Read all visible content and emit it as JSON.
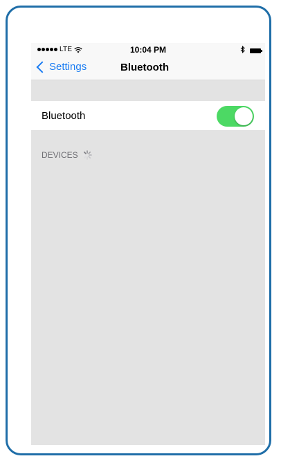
{
  "status_bar": {
    "carrier": "LTE",
    "time": "10:04 PM",
    "bluetooth_symbol": "∗"
  },
  "nav": {
    "back_label": "Settings",
    "title": "Bluetooth"
  },
  "toggle_row": {
    "label": "Bluetooth",
    "state": "on"
  },
  "devices_section": {
    "header": "DEVICES"
  },
  "colors": {
    "frame": "#1f6ea8",
    "accent_blue": "#1a7cf2",
    "toggle_on": "#4cd964",
    "screen_background": "#e3e3e3"
  },
  "icons": {
    "back": "chevron-left-icon",
    "wifi": "wifi-icon",
    "bluetooth": "bluetooth-icon",
    "battery": "battery-icon",
    "loading": "spinner-icon"
  }
}
